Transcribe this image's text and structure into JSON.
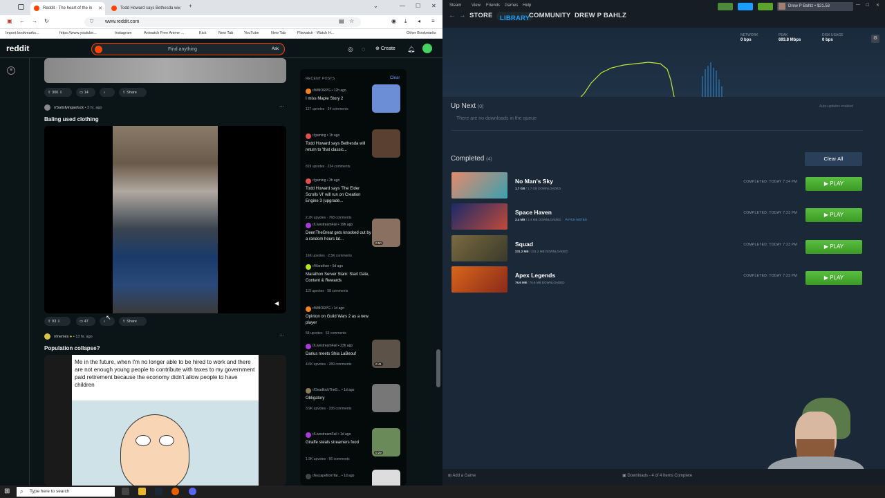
{
  "browser": {
    "tabs": [
      {
        "title": "Reddit - The heart of the in",
        "active": true
      },
      {
        "title": "Todd Howard says Bethesda wi",
        "active": false
      }
    ],
    "url": "www.reddit.com",
    "bookmarks": [
      "Import bookmarks...",
      "https://www.youtube...",
      "Instagram",
      "Aniwatch Free Anime ...",
      "Kick",
      "New Tab",
      "YouTube",
      "New Tab",
      "Flixwatch - Watch H...",
      "Other Bookmarks"
    ]
  },
  "reddit": {
    "logo": "reddit",
    "search_placeholder": "Find anything",
    "ask_label": "Ask",
    "create_label": "Create",
    "top_post": {
      "upvotes": "300",
      "comments": "14",
      "share": "Share"
    },
    "post1": {
      "subreddit": "r/Satisfyingasfuck",
      "age": "3 hr. ago",
      "title": "Baling used clothing",
      "upvotes": "93",
      "comments": "47",
      "share": "Share"
    },
    "post2": {
      "subreddit": "r/memes",
      "age": "13 hr. ago",
      "title": "Population collapse?",
      "meme_text": "Me in the future, when I'm no longer able to be hired to work and there are not enough young people to  contribute with taxes to my government paid retirement because the economy didn't allow people to have children"
    },
    "sidebar": {
      "heading": "RECENT POSTS",
      "clear": "Clear",
      "posts": [
        {
          "sub": "r/MMORPG",
          "age": "12h ago",
          "title": "I miss Maple Story 2",
          "upvotes": "127 upvotes",
          "comments": "34 comments",
          "thumb": "#6b8ed6",
          "icon": "#f58220"
        },
        {
          "sub": "r/gaming",
          "age": "1h ago",
          "title": "Todd Howard says Bethesda will return to 'that classic...",
          "upvotes": "819 upvotes",
          "comments": "234 comments",
          "thumb": "#5a4030",
          "icon": "#e34f4f"
        },
        {
          "sub": "r/gaming",
          "age": "3h ago",
          "title": "Todd Howard says 'The Elder Scrolls VI' will run on Creation Engine 3 (upgrade...",
          "upvotes": "2.2K upvotes",
          "comments": "768 comments",
          "thumb": "",
          "icon": "#e34f4f"
        },
        {
          "sub": "r/LivestreamFail",
          "age": "19h ago",
          "title": "DeenTheGreat gets knocked out by a random hours lat...",
          "upvotes": "16K upvotes",
          "comments": "2.5K comments",
          "thumb": "#8a7060",
          "icon": "#a83bd6",
          "duration": "0:50"
        },
        {
          "sub": "r/Marathon",
          "age": "5d ago",
          "title": "Marathon Server Slam: Start Date, Content & Rewards",
          "upvotes": "115 upvotes",
          "comments": "58 comments",
          "thumb": "",
          "icon": "#b5e61d"
        },
        {
          "sub": "r/MMORPG",
          "age": "1d ago",
          "title": "Opinion on Guild Wars 2 as a new player",
          "upvotes": "58 upvotes",
          "comments": "63 comments",
          "thumb": "",
          "icon": "#f58220"
        },
        {
          "sub": "r/LivestreamFail",
          "age": "23h ago",
          "title": "Darius meets Shia LaBeouf",
          "upvotes": "4.6K upvotes",
          "comments": "289 comments",
          "thumb": "#5c5248",
          "icon": "#a83bd6",
          "duration": "0:41"
        },
        {
          "sub": "r/DeadlockTheG...",
          "age": "1d ago",
          "title": "Obligatory",
          "upvotes": "3.9K upvotes",
          "comments": "335 comments",
          "thumb": "#777",
          "icon": "#8d7a5a"
        },
        {
          "sub": "r/LivestreamFail",
          "age": "1d ago",
          "title": "Giraffe steals streamers food",
          "upvotes": "1.9K upvotes",
          "comments": "66 comments",
          "thumb": "#6a8a5a",
          "icon": "#a83bd6",
          "duration": "0:29"
        },
        {
          "sub": "r/EscapefromTar...",
          "age": "1d ago",
          "title": "",
          "upvotes": "",
          "comments": "",
          "thumb": "#ddd",
          "icon": "#444"
        }
      ]
    }
  },
  "steam": {
    "menu": [
      "Steam",
      "View",
      "Friends",
      "Games",
      "Help"
    ],
    "user": "Drew P Bahlz • $21.58",
    "nav": [
      "STORE",
      "LIBRARY",
      "COMMUNITY",
      "DREW P BAHLZ"
    ],
    "stats": [
      {
        "label": "NETWORK",
        "value": "0 bps"
      },
      {
        "label": "PEAK",
        "value": "693.8 Mbps"
      },
      {
        "label": "DISK USAGE",
        "value": "0 bps"
      }
    ],
    "up_next": {
      "title": "Up Next",
      "count": "(0)",
      "empty": "There are no downloads in the queue",
      "auto": "Auto-updates enabled"
    },
    "completed": {
      "title": "Completed",
      "count": "(4)",
      "clear_all": "Clear All"
    },
    "games": [
      {
        "name": "No Man's Sky",
        "size": "1.7 GB",
        "size_rest": " / 1.7 GB DOWNLOADED",
        "patch": "",
        "completed": "COMPLETED: TODAY 7:24 PM",
        "play": "PLAY",
        "colors": [
          "#e58a6a",
          "#3aa0b0"
        ]
      },
      {
        "name": "Space Haven",
        "size": "2.4 MB",
        "size_rest": " / 2.4 MB DOWNLOADED",
        "patch": "PATCH NOTES",
        "completed": "COMPLETED: TODAY 7:23 PM",
        "play": "PLAY",
        "colors": [
          "#1a2a6a",
          "#c04a3a"
        ]
      },
      {
        "name": "Squad",
        "size": "231.2 MB",
        "size_rest": " / 231.2 MB DOWNLOADED",
        "patch": "",
        "completed": "COMPLETED: TODAY 7:23 PM",
        "play": "PLAY",
        "colors": [
          "#7a6a40",
          "#3a3a2a"
        ]
      },
      {
        "name": "Apex Legends",
        "size": "76.6 MB",
        "size_rest": " / 76.6 MB DOWNLOADED",
        "patch": "",
        "completed": "COMPLETED: TODAY 7:23 PM",
        "play": "PLAY",
        "colors": [
          "#d8661a",
          "#8a2a1a"
        ]
      }
    ],
    "footer": {
      "add_game": "Add a Game",
      "downloads": "Downloads - 4 of 4 Items Complete"
    }
  },
  "taskbar": {
    "search_placeholder": "Type here to search"
  }
}
